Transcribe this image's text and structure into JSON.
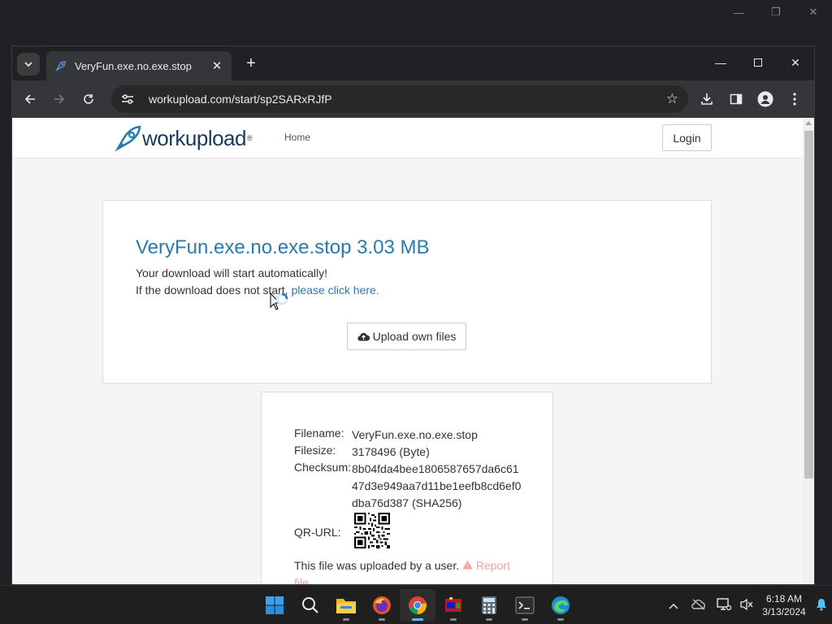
{
  "browser": {
    "tab": {
      "title": "VeryFun.exe.no.exe.stop"
    },
    "url": "workupload.com/start/sp2SARxRJfP"
  },
  "site": {
    "logo_text": "workupload",
    "nav_home": "Home",
    "login_label": "Login",
    "file_title": "VeryFun.exe.no.exe.stop 3.03 MB",
    "auto_text": "Your download will start automatically!",
    "click_prefix": "If the download does not start, ",
    "click_link": "please click here.",
    "upload_label": "Upload own files",
    "info": {
      "filename_label": "Filename:",
      "filename_value": "VeryFun.exe.no.exe.stop",
      "filesize_label": "Filesize:",
      "filesize_value": "3178496 (Byte)",
      "checksum_label": "Checksum:",
      "checksum_value": "8b04fda4bee1806587657da6c6147d3e949aa7d11be1eefb8cd6ef0dba76d387 (SHA256)",
      "qr_label": "QR-URL:",
      "uploaded_text": "This file was uploaded by a user.",
      "report_label": "Report file"
    }
  },
  "taskbar": {
    "time": "6:18 AM",
    "date": "3/13/2024"
  },
  "colors": {
    "accent": "#2a7ab0",
    "chrome_dark": "#202124",
    "toolbar": "#35363a"
  }
}
